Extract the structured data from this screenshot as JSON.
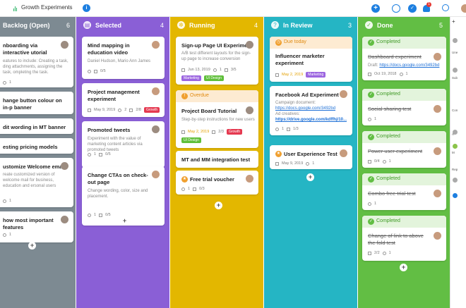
{
  "header": {
    "project_title": "Growth Experiments",
    "chevron": "⌄",
    "info_icon": "i",
    "add_icon": "+",
    "check_icon": "✓",
    "notif_count": "1"
  },
  "colors": {
    "backlog": "#7d8a92",
    "selected": "#8a5fd6",
    "running": "#e3b700",
    "review": "#25b5c4",
    "done": "#62be44",
    "panel": "#3a3f45"
  },
  "columns": {
    "backlog": {
      "title": "Backlog (Open)",
      "count": "6"
    },
    "selected": {
      "title": "Selected",
      "count": "4"
    },
    "running": {
      "title": "Running",
      "count": "4"
    },
    "review": {
      "title": "In Review",
      "count": "3"
    },
    "done": {
      "title": "Done",
      "count": "5"
    }
  },
  "backlog_cards": [
    {
      "title": "nboarding via interactive utorial",
      "desc": "eatures to include: Creating a task, ding attachments, assigning the task, ompleting the task.",
      "meta": "1"
    },
    {
      "title": "hange button colour on in-p banner"
    },
    {
      "title": "dit wording in MT banner"
    },
    {
      "title": "esting pricing models"
    },
    {
      "title": "ustomize Welcome email",
      "desc": "reate customized version of welcome mail for business, education and ersonal users",
      "meta": "1"
    },
    {
      "title": "how most important features",
      "meta": "1"
    }
  ],
  "selected_cards": [
    {
      "title": "Mind mapping in education video",
      "desc": "Daniel Hudson, Mario Ann James",
      "meta": "0/5"
    },
    {
      "title": "Project management experiment",
      "date": "May 9, 2019",
      "comments": "2",
      "checklist": "2/8",
      "tag": "Growth"
    },
    {
      "title": "Promoted tweets",
      "desc": "Experiment with the value of marketing content articles via promoted tweets",
      "meta": "1",
      "check": "0/5"
    },
    {
      "title": "Change CTAs on check-out page",
      "desc": "Change wording, color, size and placement.",
      "meta": "1",
      "check": "0/5"
    }
  ],
  "running_cards": [
    {
      "title": "Sign-up Page UI Experiment",
      "desc": "A/B test different layouts for the sign-up page to increase conversion",
      "date": "Jun 13, 2019",
      "comments": "1",
      "checklist": "3/5",
      "tag1": "Marketing",
      "tag2": "UI Design"
    },
    {
      "status": "Overdue",
      "title": "Project Board Tutorial",
      "desc": "Step-by-step instructions for new users",
      "date": "May 2, 2019",
      "checklist": "2/3",
      "tag1": "Growth",
      "tag2": "UI Design"
    },
    {
      "title": "MT and MM integration test"
    },
    {
      "title": "Free trial voucher",
      "meta": "1",
      "check": "0/3"
    }
  ],
  "review_cards": [
    {
      "status": "Due today",
      "title": "Influencer marketer experiment",
      "date": "May 2, 2019",
      "tag": "Marketing"
    },
    {
      "title": "Facebook Ad Experiment",
      "desc1": "Campaign document:",
      "link1": "https://docs.google.com/3492bd",
      "desc2": "Ad creatives:",
      "link2": "https://drive.google.com/kdffhj/10...",
      "meta": "1",
      "check": "1/3"
    },
    {
      "title": "User Experience Test",
      "date": "May 9, 2019",
      "comments": "1"
    }
  ],
  "done_cards": [
    {
      "status": "Completed",
      "title": "Dashboard experiment",
      "draft_label": "Draft:",
      "link": "https://docs.google.com/3492bd",
      "date": "Oct 19, 2018",
      "comments": "1"
    },
    {
      "status": "Completed",
      "title": "Social sharing test",
      "meta": "1"
    },
    {
      "status": "Completed",
      "title": "Power user experiment",
      "check": "0/4",
      "meta": "1"
    },
    {
      "status": "Completed",
      "title": "Combo free trial test",
      "meta": "1"
    },
    {
      "status": "Completed",
      "title": "Change of link to above the fold test",
      "check": "2/2",
      "meta": "1"
    }
  ],
  "right_panel": {
    "labels": [
      "Une",
      "Sub",
      "Con",
      "A",
      "M",
      "Rep"
    ]
  },
  "add_label": "+"
}
